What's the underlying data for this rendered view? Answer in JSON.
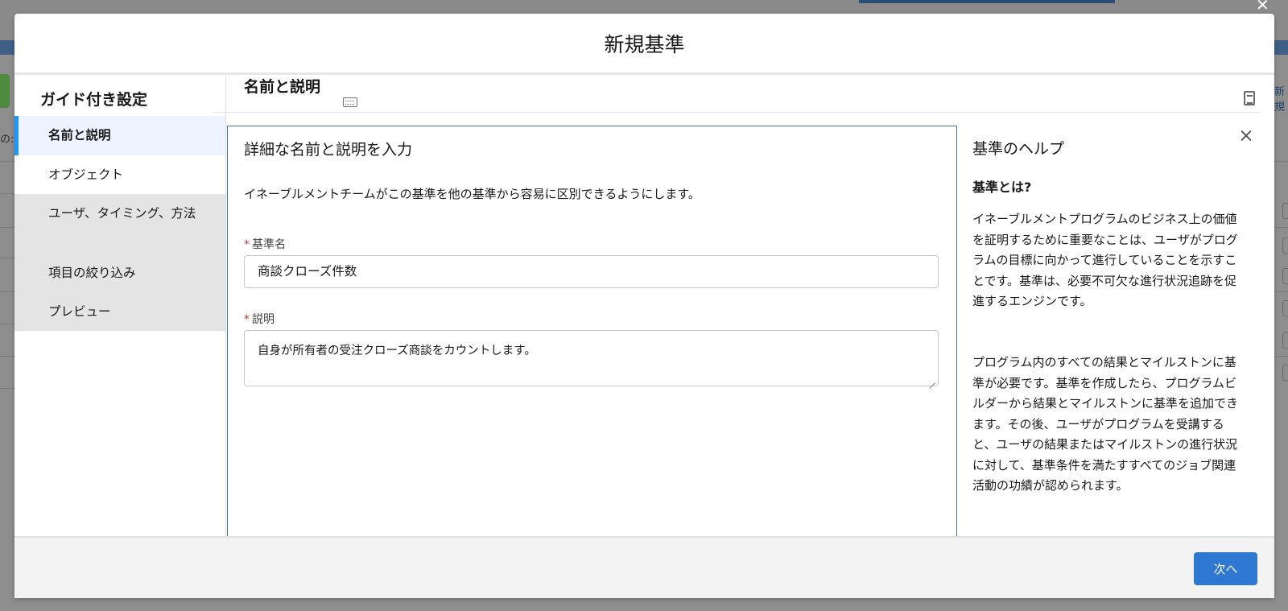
{
  "background": {
    "left_text": "の:",
    "right_text": "新規"
  },
  "modal": {
    "title": "新規基準"
  },
  "sidebar": {
    "heading": "ガイド付き設定",
    "items": [
      {
        "label": "名前と説明",
        "state": "selected"
      },
      {
        "label": "オブジェクト",
        "state": "default"
      },
      {
        "label": "ユーザ、タイミング、方法",
        "state": "disabled"
      },
      {
        "label": "項目の絞り込み",
        "state": "disabled"
      },
      {
        "label": "プレビュー",
        "state": "disabled"
      }
    ]
  },
  "main": {
    "title": "名前と説明",
    "title_icon": "keyboard-icon",
    "help_toggle_icon": "document-icon",
    "form": {
      "heading": "詳細な名前と説明を入力",
      "description": "イネーブルメントチームがこの基準を他の基準から容易に区別できるようにします。",
      "required_marker": "*",
      "name_label": "基準名",
      "name_value": "商談クローズ件数",
      "desc_label": "説明",
      "desc_value": "自身が所有者の受注クローズ商談をカウントします。"
    }
  },
  "help": {
    "title": "基準のヘルプ",
    "subtitle": "基準とは?",
    "paragraph1": "イネーブルメントプログラムのビジネス上の価値を証明するために重要なことは、ユーザがプログラムの目標に向かって進行していることを示すことです。基準は、必要不可欠な進行状況追跡を促進するエンジンです。",
    "paragraph2": "プログラム内のすべての結果とマイルストンに基準が必要です。基準を作成したら、プログラムビルダーから結果とマイルストンに基準を追加できます。その後、ユーザがプログラムを受講すると、ユーザの結果またはマイルストンの進行状況に対して、基準条件を満たすすべてのジョブ関連活動の功績が認められます。"
  },
  "footer": {
    "next_label": "次へ"
  },
  "colors": {
    "accent": "#1b96ff",
    "button": "#2e78d2",
    "required": "#c23934",
    "selected_bg": "#eef4ff",
    "disabled_bg": "#e4e4e4"
  }
}
